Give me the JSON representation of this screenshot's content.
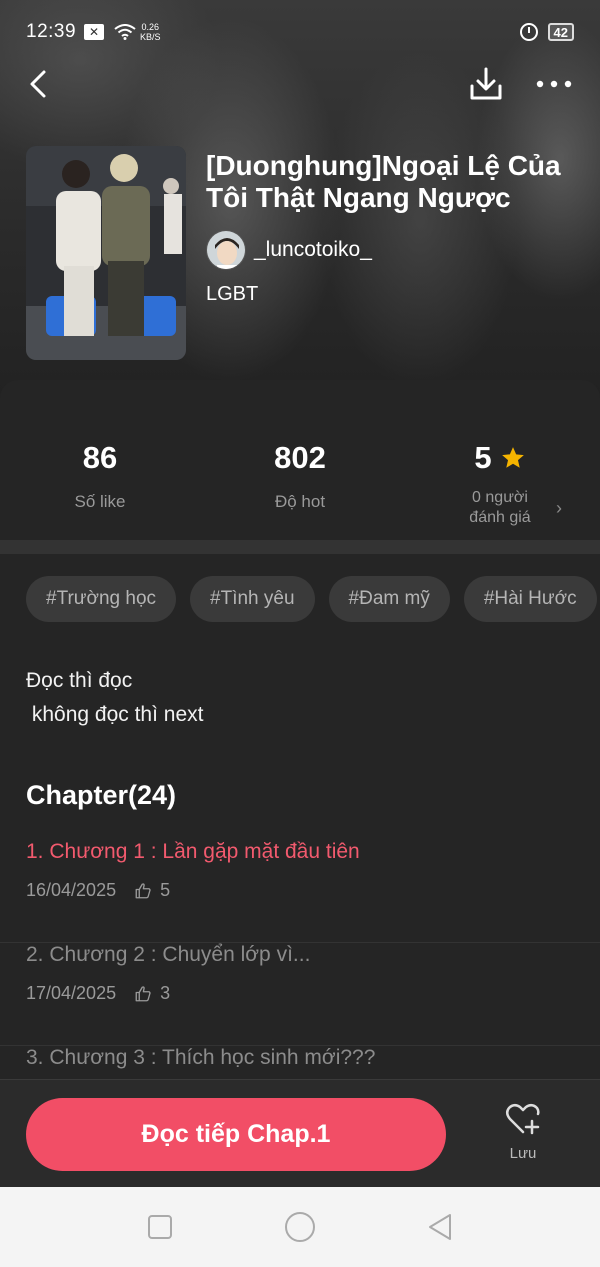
{
  "status_bar": {
    "time": "12:39",
    "net_speed_value": "0.26",
    "net_speed_unit": "KB/S",
    "battery": "42"
  },
  "book": {
    "title": "[Duonghung]Ngoại Lệ Của Tôi Thật Ngang Ngược",
    "author": "_luncotoiko_",
    "genre": "LGBT"
  },
  "stats": {
    "likes_value": "86",
    "likes_label": "Số like",
    "hot_value": "802",
    "hot_label": "Độ hot",
    "rating_value": "5",
    "rating_label_line1": "0 người",
    "rating_label_line2": "đánh giá"
  },
  "tags": [
    "#Trường học",
    "#Tình yêu",
    "#Đam mỹ",
    "#Hài Hước"
  ],
  "description": "Đọc thì đọc\n không đọc thì next",
  "chapters_heading": "Chapter(24)",
  "chapters": [
    {
      "title": "1. Chương 1 : Lần gặp mặt đầu tiên",
      "date": "16/04/2025",
      "likes": "5"
    },
    {
      "title": "2. Chương 2 : Chuyển lớp vì...",
      "date": "17/04/2025",
      "likes": "3"
    },
    {
      "title": "3. Chương 3 : Thích học sinh mới???",
      "date": "",
      "likes": ""
    }
  ],
  "actions": {
    "read_label": "Đọc tiếp Chap.1",
    "save_label": "Lưu"
  },
  "colors": {
    "accent": "#f24e66",
    "active_chapter": "#f25a6e",
    "star": "#f5b400"
  }
}
